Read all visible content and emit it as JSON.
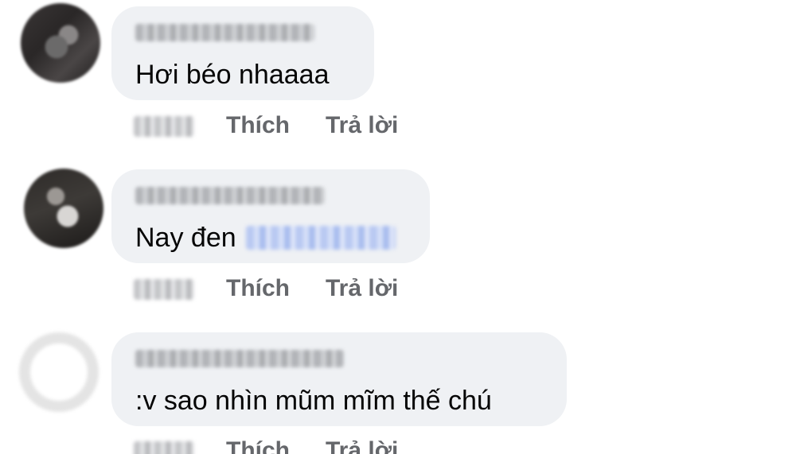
{
  "comments": [
    {
      "text": "Hơi béo nhaaaa",
      "actions": {
        "like": "Thích",
        "reply": "Trả lời"
      }
    },
    {
      "text": "Nay đen",
      "actions": {
        "like": "Thích",
        "reply": "Trả lời"
      }
    },
    {
      "text": ":v sao nhìn mũm mĩm thế chú",
      "actions": {
        "like": "Thích",
        "reply": "Trả lời"
      }
    }
  ],
  "colors": {
    "bubble": "#eff1f4",
    "text": "#050505",
    "action": "#65676b",
    "mention": "#b9c9f2"
  }
}
